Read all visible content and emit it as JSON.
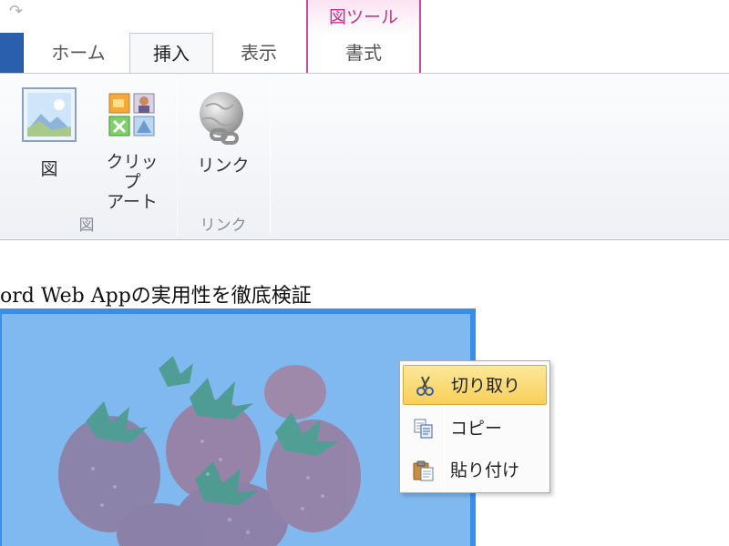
{
  "tabs": {
    "home": "ホーム",
    "insert": "挿入",
    "view": "表示",
    "format": "書式"
  },
  "contextual_tab_group": {
    "label": "図ツール",
    "color": "#d04a9e"
  },
  "ribbon": {
    "buttons": {
      "picture": {
        "label": "図",
        "icon": "picture-icon"
      },
      "clipart": {
        "label_line1": "クリップ",
        "label_line2": "アート",
        "icon": "clipart-icon"
      },
      "link": {
        "label": "リンク",
        "icon": "link-globe-icon"
      }
    },
    "groups": {
      "image": "図",
      "link": "リンク"
    }
  },
  "document": {
    "heading": "ord Web Appの実用性を徹底検証",
    "image": {
      "subject": "strawberries",
      "selection_color": "#3b8ee8"
    }
  },
  "context_menu": {
    "items": [
      {
        "label": "切り取り",
        "icon": "scissors-icon",
        "highlighted": true
      },
      {
        "label": "コピー",
        "icon": "copy-icon",
        "highlighted": false
      },
      {
        "label": "貼り付け",
        "icon": "paste-icon",
        "highlighted": false
      }
    ]
  },
  "colors": {
    "file_tab": "#2a5fae",
    "highlight": "#f8cf58"
  }
}
